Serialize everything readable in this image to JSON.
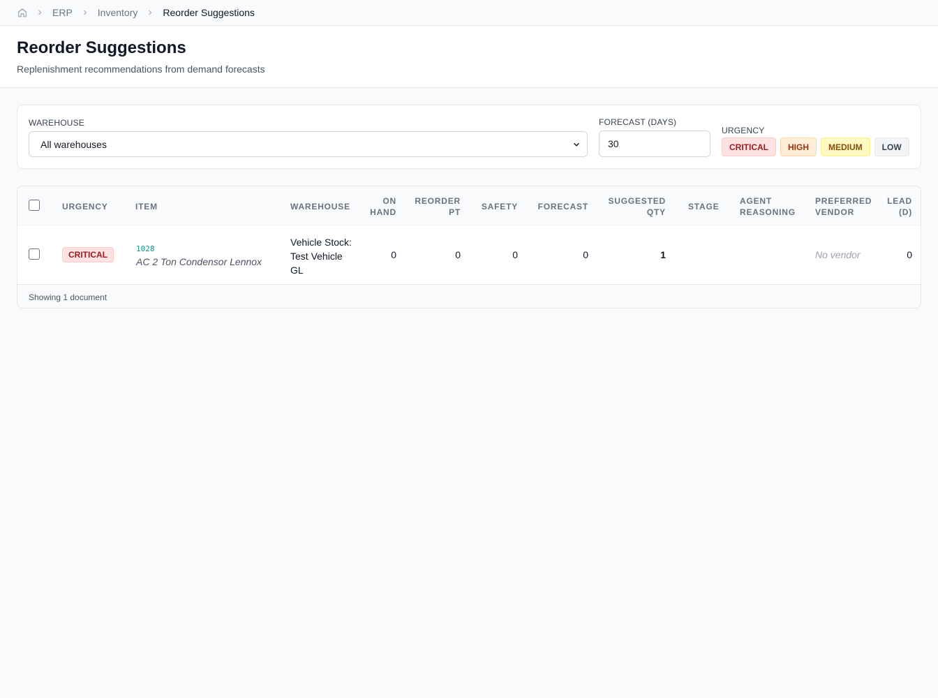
{
  "breadcrumb": {
    "items": [
      "ERP",
      "Inventory",
      "Reorder Suggestions"
    ]
  },
  "header": {
    "title": "Reorder Suggestions",
    "subtitle": "Replenishment recommendations from demand forecasts"
  },
  "filters": {
    "warehouse_label": "WAREHOUSE",
    "warehouse_value": "All warehouses",
    "forecast_label": "FORECAST (DAYS)",
    "forecast_value": "30",
    "urgency_label": "URGENCY",
    "urgency_options": [
      "CRITICAL",
      "HIGH",
      "MEDIUM",
      "LOW"
    ]
  },
  "table": {
    "columns": {
      "urgency": "URGENCY",
      "item": "ITEM",
      "warehouse": "WAREHOUSE",
      "on_hand_1": "ON",
      "on_hand_2": "HAND",
      "reorder_pt_1": "REORDER",
      "reorder_pt_2": "PT",
      "safety": "SAFETY",
      "forecast": "FORECAST",
      "suggested_qty_1": "SUGGESTED",
      "suggested_qty_2": "QTY",
      "stage": "STAGE",
      "agent_reasoning_1": "AGENT",
      "agent_reasoning_2": "REASONING",
      "preferred_vendor_1": "PREFERRED",
      "preferred_vendor_2": "VENDOR",
      "lead_1": "LEAD",
      "lead_2": "(D)"
    },
    "rows": [
      {
        "urgency": "CRITICAL",
        "item_code": "1028",
        "item_name": "AC 2 Ton Condensor Lennox",
        "warehouse": "Vehicle Stock: Test Vehicle GL",
        "on_hand": "0",
        "reorder_pt": "0",
        "safety": "0",
        "forecast": "0",
        "suggested_qty": "1",
        "stage": "",
        "agent_reasoning": "",
        "preferred_vendor": "No vendor",
        "lead": "0"
      }
    ],
    "footer": "Showing 1 document"
  },
  "colors": {
    "accent_teal": "#0d9488",
    "critical_bg": "#fee2e2",
    "critical_text": "#991b1b"
  }
}
